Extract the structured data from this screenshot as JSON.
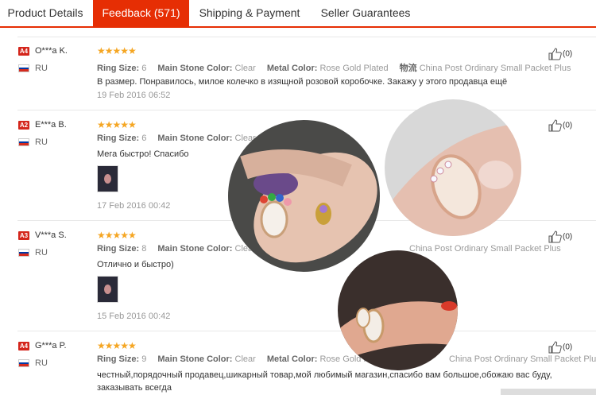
{
  "tabs": [
    {
      "label": "Product Details"
    },
    {
      "label": "Feedback (571)"
    },
    {
      "label": "Shipping & Payment"
    },
    {
      "label": "Seller Guarantees"
    }
  ],
  "labels": {
    "ring_size": "Ring Size:",
    "stone": "Main Stone Color:",
    "metal": "Metal Color:",
    "shipping": "物流"
  },
  "reviews": [
    {
      "level": "A4",
      "name": "O***a K.",
      "country": "RU",
      "stars": "★★★★★",
      "ring_size": "6",
      "stone": "Clear",
      "metal": "Rose Gold Plated",
      "shipping": "China Post Ordinary Small Packet Plus",
      "text": "В размер. Понравилось, милое колечко в изящной розовой коробочке. Закажу у этого продавца ещё",
      "date": "19 Feb 2016 06:52",
      "likes": "(0)"
    },
    {
      "level": "A2",
      "name": "E***a B.",
      "country": "RU",
      "stars": "★★★★★",
      "ring_size": "6",
      "stone": "Clear",
      "metal": "",
      "shipping": "",
      "text": "Мега быстро! Спасибо",
      "date": "17 Feb 2016 00:42",
      "likes": "(0)"
    },
    {
      "level": "A3",
      "name": "V***a S.",
      "country": "RU",
      "stars": "★★★★★",
      "ring_size": "8",
      "stone": "Clear",
      "metal": "",
      "shipping": "China Post Ordinary Small Packet Plus",
      "text": "Отлично и быстро)",
      "date": "15 Feb 2016 00:42",
      "likes": "(0)"
    },
    {
      "level": "A4",
      "name": "G***a P.",
      "country": "RU",
      "stars": "★★★★★",
      "ring_size": "9",
      "stone": "Clear",
      "metal": "Rose Gold Plated",
      "shipping": "China Post Ordinary Small Packet Plus",
      "text": "честный,порядочный продавец,шикарный товар,мой любимый магазин,спасибо вам большое,обожаю вас буду, заказывать всегда",
      "date": "",
      "likes": "(0)"
    }
  ],
  "colors": {
    "accent": "#e62e04",
    "star": "#f5a623",
    "level_badge": "#d4261c"
  }
}
